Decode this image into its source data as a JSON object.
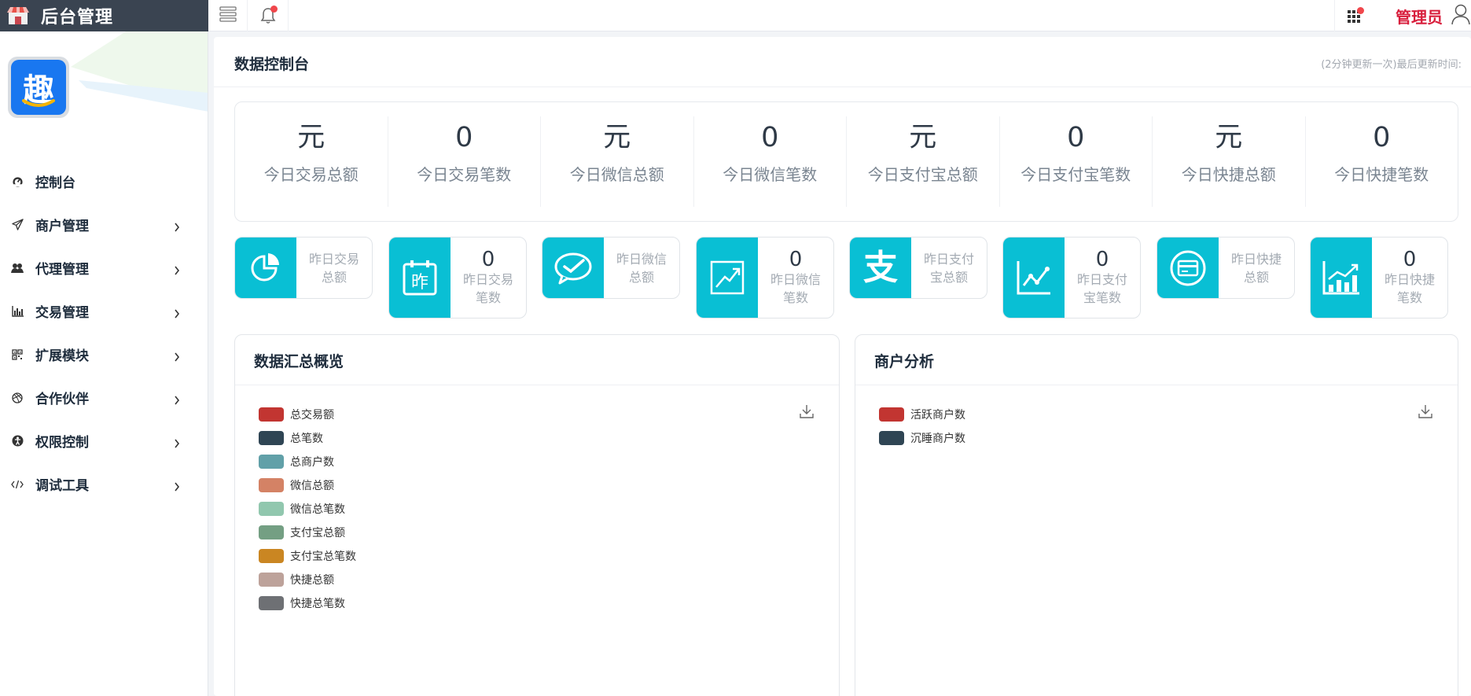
{
  "brand": {
    "title": "后台管理"
  },
  "topbar": {
    "user_name": "管理员"
  },
  "sidebar": {
    "items": [
      {
        "label": "控制台",
        "icon": "dashboard-icon",
        "has_children": false
      },
      {
        "label": "商户管理",
        "icon": "paper-plane-icon",
        "has_children": true
      },
      {
        "label": "代理管理",
        "icon": "users-icon",
        "has_children": true
      },
      {
        "label": "交易管理",
        "icon": "bar-chart-icon",
        "has_children": true
      },
      {
        "label": "扩展模块",
        "icon": "qrcode-icon",
        "has_children": true
      },
      {
        "label": "合作伙伴",
        "icon": "dribbble-icon",
        "has_children": true
      },
      {
        "label": "权限控制",
        "icon": "accessibility-icon",
        "has_children": true
      },
      {
        "label": "调试工具",
        "icon": "code-icon",
        "has_children": true
      }
    ]
  },
  "main": {
    "title": "数据控制台",
    "update_note": "(2分钟更新一次)最后更新时间:"
  },
  "stats": [
    {
      "value": "元",
      "label": "今日交易总额"
    },
    {
      "value": "0",
      "label": "今日交易笔数"
    },
    {
      "value": "元",
      "label": "今日微信总额"
    },
    {
      "value": "0",
      "label": "今日微信笔数"
    },
    {
      "value": "元",
      "label": "今日支付宝总额"
    },
    {
      "value": "0",
      "label": "今日支付宝笔数"
    },
    {
      "value": "元",
      "label": "今日快捷总额"
    },
    {
      "value": "0",
      "label": "今日快捷笔数"
    }
  ],
  "cards": [
    {
      "value": "",
      "label": "昨日交易总额",
      "icon": "pie-chart-icon"
    },
    {
      "value": "0",
      "label": "昨日交易笔数",
      "icon": "calendar-icon",
      "icon_text": "昨"
    },
    {
      "value": "",
      "label": "昨日微信总额",
      "icon": "wechat-icon"
    },
    {
      "value": "0",
      "label": "昨日微信笔数",
      "icon": "trend-chart-icon"
    },
    {
      "value": "",
      "label": "昨日支付宝总额",
      "icon": "alipay-icon",
      "icon_text": "支"
    },
    {
      "value": "0",
      "label": "昨日支付宝笔数",
      "icon": "line-chart-icon"
    },
    {
      "value": "",
      "label": "昨日快捷总额",
      "icon": "credit-card-icon"
    },
    {
      "value": "0",
      "label": "昨日快捷笔数",
      "icon": "growth-chart-icon"
    }
  ],
  "panels": {
    "summary": {
      "title": "数据汇总概览",
      "legend": [
        {
          "label": "总交易额",
          "color": "#c23531"
        },
        {
          "label": "总笔数",
          "color": "#2f4554"
        },
        {
          "label": "总商户数",
          "color": "#61a0a8"
        },
        {
          "label": "微信总额",
          "color": "#d48265"
        },
        {
          "label": "微信总笔数",
          "color": "#91c7ae"
        },
        {
          "label": "支付宝总额",
          "color": "#749f83"
        },
        {
          "label": "支付宝总笔数",
          "color": "#ca8622"
        },
        {
          "label": "快捷总额",
          "color": "#bda29a"
        },
        {
          "label": "快捷总笔数",
          "color": "#6e7074"
        }
      ]
    },
    "merchant": {
      "title": "商户分析",
      "legend": [
        {
          "label": "活跃商户数",
          "color": "#c23531"
        },
        {
          "label": "沉睡商户数",
          "color": "#2f4554"
        }
      ]
    }
  },
  "colors": {
    "accent": "#09bfd4",
    "header_dark": "#3a4451",
    "user_red": "#d81e3c"
  }
}
